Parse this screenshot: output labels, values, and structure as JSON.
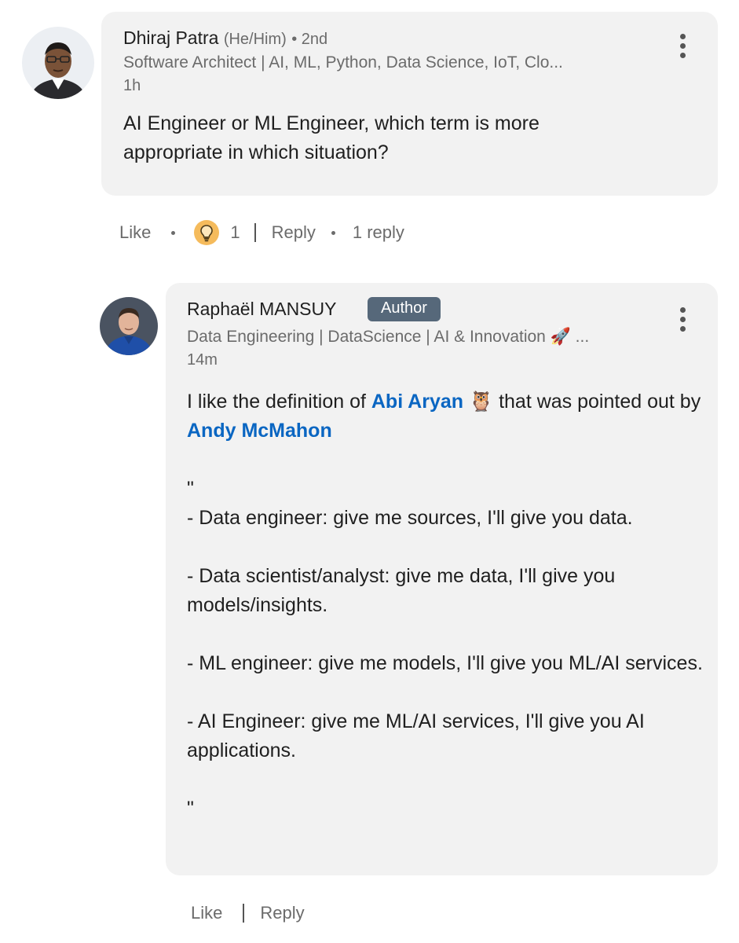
{
  "comment": {
    "author": "Dhiraj Patra",
    "pronouns": "(He/Him)",
    "degree": "• 2nd",
    "headline": "Software Architect | AI, ML, Python, Data Science, IoT, Clo...",
    "time": "1h",
    "text": "AI Engineer or ML Engineer,  which term is more appropriate in which situation?",
    "actions": {
      "like": "Like",
      "reaction_count": "1",
      "reply": "Reply",
      "replies": "1 reply"
    }
  },
  "reply": {
    "author": "Raphaël MANSUY",
    "badge": "Author",
    "headline": "Data Engineering | DataScience | AI & Innovation 🚀 ...",
    "time": "14m",
    "intro_1": "I like the definition of ",
    "mention_1": "Abi Aryan",
    "owl": "🦉",
    "intro_2": " that was pointed out by ",
    "mention_2": "Andy McMahon",
    "quote_open": "\"",
    "line_1": "- Data engineer: give me sources,  I'll give you data.",
    "line_2": "- Data scientist/analyst: give me data,  I'll give you models/insights.",
    "line_3": "- ML engineer: give me models,  I'll give you ML/AI services.",
    "line_4": "- AI Engineer: give me ML/AI services,  I'll give you AI applications.",
    "quote_close": "\"",
    "actions": {
      "like": "Like",
      "reply": "Reply"
    }
  },
  "icons": {
    "reaction": "lightbulb-icon",
    "menu": "more-options-icon"
  },
  "colors": {
    "bubble": "#f2f2f2",
    "mention": "#0a66c2",
    "author_badge": "#56687a",
    "reaction_badge": "#f5bb5c"
  }
}
